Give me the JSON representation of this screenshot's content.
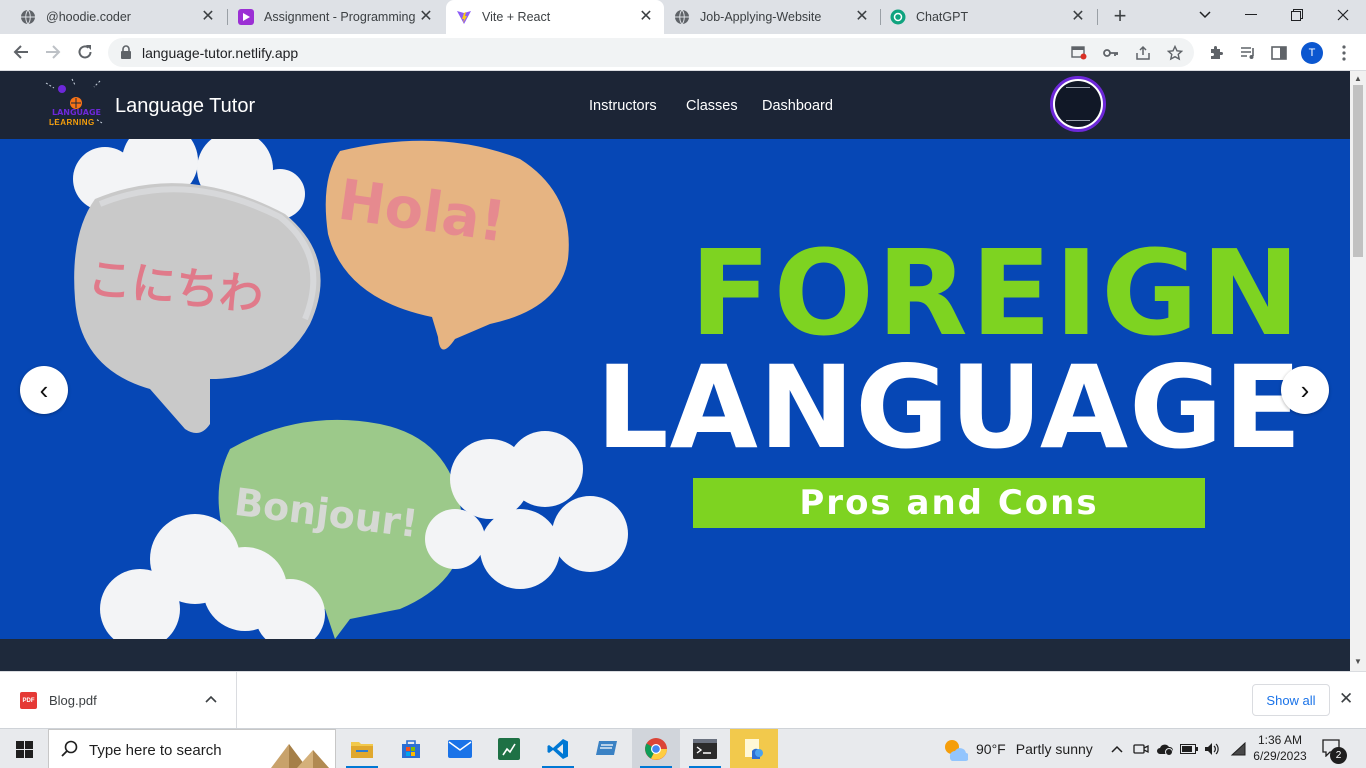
{
  "browser": {
    "tabs": [
      {
        "title": "@hoodie.coder",
        "favicon": "globe-icon",
        "active": false
      },
      {
        "title": "Assignment - Programming H",
        "favicon": "play-icon",
        "active": false
      },
      {
        "title": "Vite + React",
        "favicon": "vite-icon",
        "active": true
      },
      {
        "title": "Job-Applying-Website",
        "favicon": "globe-icon",
        "active": false
      },
      {
        "title": "ChatGPT",
        "favicon": "chatgpt-icon",
        "active": false
      }
    ],
    "new_tab_label": "+",
    "url": "language-tutor.netlify.app",
    "profile_initial": "T"
  },
  "site": {
    "brand": "Language Tutor",
    "logo_text": "LEARNING",
    "nav": [
      {
        "label": "Instructors"
      },
      {
        "label": "Classes"
      },
      {
        "label": "Dashboard"
      }
    ]
  },
  "hero": {
    "bubbles": {
      "japanese": "こにちわ",
      "spanish": "Hola!",
      "french": "Bonjour!"
    },
    "title_line1": "FOREIGN",
    "title_line2": "LANGUAGE",
    "banner": "Pros and Cons",
    "prev_label": "‹",
    "next_label": "›"
  },
  "downloads": {
    "file_name": "Blog.pdf",
    "file_type": "PDF",
    "show_all": "Show all"
  },
  "taskbar": {
    "search_placeholder": "Type here to search",
    "weather_temp": "90°F",
    "weather_text": "Partly sunny",
    "time": "1:36 AM",
    "date": "6/29/2023",
    "notification_count": "2"
  },
  "colors": {
    "hero_bg": "#0647b5",
    "hero_green": "#7ed321",
    "nav_bg": "#1c2536",
    "avatar_ring": "#6d28d9"
  }
}
